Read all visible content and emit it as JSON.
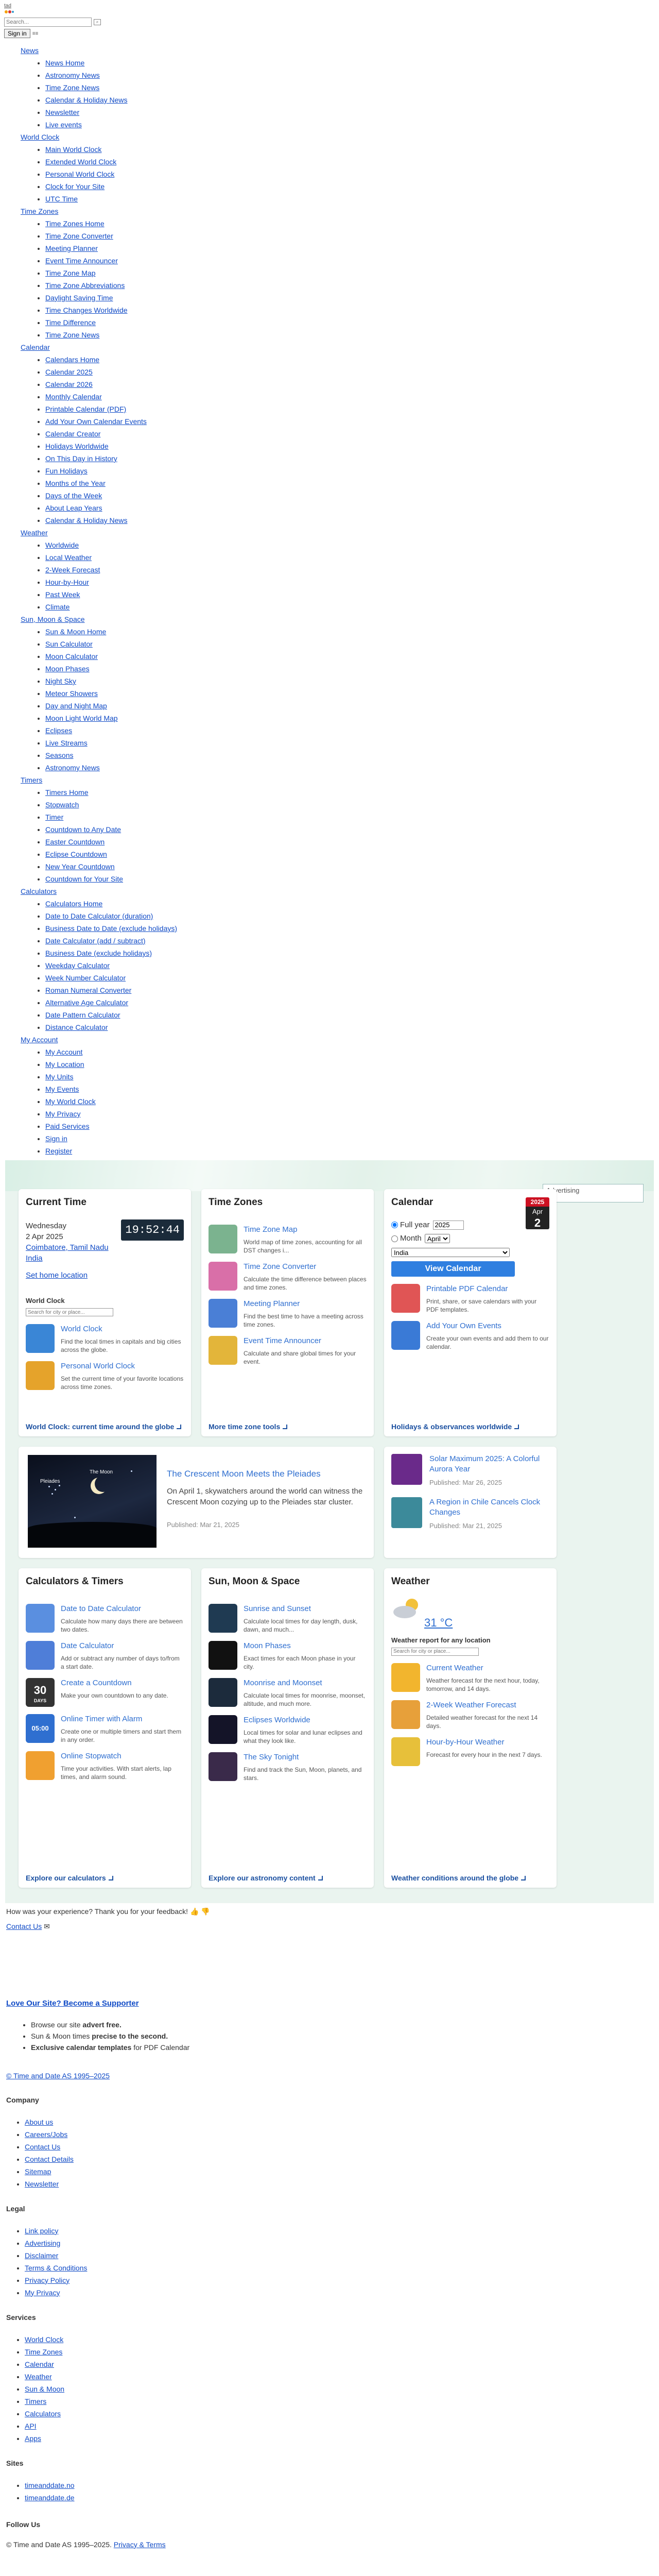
{
  "header": {
    "logo_label": "tad",
    "search_placeholder": "Search...",
    "search_button": "⌕",
    "signin_label": "Sign in",
    "menu_toggle": "≡≡"
  },
  "nav": [
    {
      "label": "News",
      "items": [
        "News Home",
        "Astronomy News",
        "Time Zone News",
        "Calendar & Holiday News",
        "Newsletter",
        "Live events"
      ]
    },
    {
      "label": "World Clock",
      "items": [
        "Main World Clock",
        "Extended World Clock",
        "Personal World Clock",
        "Clock for Your Site",
        "UTC Time"
      ]
    },
    {
      "label": "Time Zones",
      "items": [
        "Time Zones Home",
        "Time Zone Converter",
        "Meeting Planner",
        "Event Time Announcer",
        "Time Zone Map",
        "Time Zone Abbreviations",
        "Daylight Saving Time",
        "Time Changes Worldwide",
        "Time Difference",
        "Time Zone News"
      ]
    },
    {
      "label": "Calendar",
      "items": [
        "Calendars Home",
        "Calendar 2025",
        "Calendar 2026",
        "Monthly Calendar",
        "Printable Calendar (PDF)",
        "Add Your Own Calendar Events",
        "Calendar Creator",
        "Holidays Worldwide",
        "On This Day in History",
        "Fun Holidays",
        "Months of the Year",
        "Days of the Week",
        "About Leap Years",
        "Calendar & Holiday News"
      ]
    },
    {
      "label": "Weather",
      "items": [
        "Worldwide",
        "Local Weather",
        "2-Week Forecast",
        "Hour-by-Hour",
        "Past Week",
        "Climate"
      ]
    },
    {
      "label": "Sun, Moon & Space",
      "items": [
        "Sun & Moon Home",
        "Sun Calculator",
        "Moon Calculator",
        "Moon Phases",
        "Night Sky",
        "Meteor Showers",
        "Day and Night Map",
        "Moon Light World Map",
        "Eclipses",
        "Live Streams",
        "Seasons",
        "Astronomy News"
      ]
    },
    {
      "label": "Timers",
      "items": [
        "Timers Home",
        "Stopwatch",
        "Timer",
        "Countdown to Any Date",
        "Easter Countdown",
        "Eclipse Countdown",
        "New Year Countdown",
        "Countdown for Your Site"
      ]
    },
    {
      "label": "Calculators",
      "items": [
        "Calculators Home",
        "Date to Date Calculator (duration)",
        "Business Date to Date (exclude holidays)",
        "Date Calculator (add / subtract)",
        "Business Date (exclude holidays)",
        "Weekday Calculator",
        "Week Number Calculator",
        "Roman Numeral Converter",
        "Alternative Age Calculator",
        "Date Pattern Calculator",
        "Distance Calculator"
      ]
    },
    {
      "label": "My Account",
      "items": [
        "My Account",
        "My Location",
        "My Units",
        "My Events",
        "My World Clock",
        "My Privacy",
        "Paid Services",
        "Sign in",
        "Register"
      ]
    }
  ],
  "advertising": "Advertising",
  "current_time": {
    "title": "Current Time",
    "clock": "19:52:44",
    "weekday": "Wednesday",
    "date": "2 Apr 2025",
    "city": "Coimbatore, Tamil Nadu",
    "country": "India",
    "set_home": "Set home location",
    "world_clock_title": "World Clock",
    "wc_search_placeholder": "Search for city or place...",
    "tools": [
      {
        "title": "World Clock",
        "desc": "Find the local times in capitals and big cities across the globe.",
        "icon": "globe-icon",
        "color": "#3a86d6"
      },
      {
        "title": "Personal World Clock",
        "desc": "Set the current time of your favorite locations across time zones.",
        "icon": "clock-person-icon",
        "color": "#e5a32b"
      }
    ],
    "footer": "World Clock: current time around the globe"
  },
  "time_zones": {
    "title": "Time Zones",
    "tools": [
      {
        "title": "Time Zone Map",
        "desc": "World map of time zones, accounting for all DST changes i...",
        "icon": "map-icon",
        "color": "#7bb38f"
      },
      {
        "title": "Time Zone Converter",
        "desc": "Calculate the time difference between places and time zones.",
        "icon": "converter-icon",
        "color": "#d96fa8"
      },
      {
        "title": "Meeting Planner",
        "desc": "Find the best time to have a meeting across time zones.",
        "icon": "meeting-icon",
        "color": "#4a7fd6"
      },
      {
        "title": "Event Time Announcer",
        "desc": "Calculate and share global times for your event.",
        "icon": "announcer-icon",
        "color": "#e3b53a"
      }
    ],
    "footer": "More time zone tools"
  },
  "calendar": {
    "title": "Calendar",
    "full_year_label": "Full year",
    "year_value": "2025",
    "month_label": "Month",
    "month_value": "April",
    "country_value": "India",
    "view_button": "View Calendar",
    "badge_year": "2025",
    "badge_month": "Apr",
    "badge_day": "2",
    "tools": [
      {
        "title": "Printable PDF Calendar",
        "desc": "Print, share, or save calendars with your PDF templates.",
        "icon": "pdf-icon",
        "color": "#e05555"
      },
      {
        "title": "Add Your Own Events",
        "desc": "Create your own events and add them to our calendar.",
        "icon": "add-event-icon",
        "color": "#3a7ad6"
      }
    ],
    "footer": "Holidays & observances worldwide"
  },
  "news": {
    "main": {
      "title": "The Crescent Moon Meets the Pleiades",
      "desc": "On April 1, skywatchers around the world can witness the Crescent Moon cozying up to the Pleiades star cluster.",
      "published": "Published: Mar 21, 2025",
      "img_label_1": "The Moon",
      "img_label_2": "Pleiades"
    },
    "side": [
      {
        "title": "Solar Maximum 2025: A Colorful Aurora Year",
        "published": "Published: Mar 26, 2025",
        "color": "#6a2a8a"
      },
      {
        "title": "A Region in Chile Cancels Clock Changes",
        "published": "Published: Mar 21, 2025",
        "color": "#3c8a9a"
      }
    ]
  },
  "calculators": {
    "title": "Calculators & Timers",
    "tools": [
      {
        "title": "Date to Date Calculator",
        "desc": "Calculate how many days there are between two dates.",
        "icon": "calendar-calc-icon",
        "color": "#5a8fe0"
      },
      {
        "title": "Date Calculator",
        "desc": "Add or subtract any number of days to/from a start date.",
        "icon": "date-calc-icon",
        "color": "#4f7ed8"
      },
      {
        "title": "Create a Countdown",
        "desc": "Make your own countdown to any date.",
        "icon": "countdown-icon",
        "color": "#333333",
        "badge": "30",
        "badge_sub": "DAYS"
      },
      {
        "title": "Online Timer with Alarm",
        "desc": "Create one or multiple timers and start them in any order.",
        "icon": "timer-icon",
        "color": "#2f6fd0",
        "badge": "05:00"
      },
      {
        "title": "Online Stopwatch",
        "desc": "Time your activities. With start alerts, lap times, and alarm sound.",
        "icon": "stopwatch-icon",
        "color": "#f0a030"
      }
    ],
    "footer": "Explore our calculators"
  },
  "astro": {
    "title": "Sun, Moon & Space",
    "tools": [
      {
        "title": "Sunrise and Sunset",
        "desc": "Calculate local times for day length, dusk, dawn, and much...",
        "icon": "sunrise-icon",
        "color": "#1f3a52"
      },
      {
        "title": "Moon Phases",
        "desc": "Exact times for each Moon phase in your city.",
        "icon": "moon-phase-icon",
        "color": "#111111"
      },
      {
        "title": "Moonrise and Moonset",
        "desc": "Calculate local times for moonrise, moonset, altitude, and much more.",
        "icon": "moonrise-icon",
        "color": "#1c2b3c"
      },
      {
        "title": "Eclipses Worldwide",
        "desc": "Local times for solar and lunar eclipses and what they look like.",
        "icon": "eclipse-icon",
        "color": "#141428"
      },
      {
        "title": "The Sky Tonight",
        "desc": "Find and track the Sun, Moon, planets, and stars.",
        "icon": "sky-icon",
        "color": "#3a2a4a"
      }
    ],
    "footer": "Explore our astronomy content"
  },
  "weather": {
    "title": "Weather",
    "temp": "31 °C",
    "report_label": "Weather report for any location",
    "search_placeholder": "Search for city or place...",
    "tools": [
      {
        "title": "Current Weather",
        "desc": "Weather forecast for the next hour, today, tomorrow, and 14 days.",
        "icon": "weather-icon",
        "color": "#f2b52e"
      },
      {
        "title": "2-Week Weather Forecast",
        "desc": "Detailed weather forecast for the next 14 days.",
        "icon": "forecast-icon",
        "color": "#e7a03a"
      },
      {
        "title": "Hour-by-Hour Weather",
        "desc": "Forecast for every hour in the next 7 days.",
        "icon": "hourly-icon",
        "color": "#e7c03a"
      }
    ],
    "footer": "Weather conditions around the globe"
  },
  "feedback": {
    "text": "How was your experience? Thank you for your feedback!",
    "contact": "Contact Us"
  },
  "supporter": {
    "title": "Love Our Site? Become a Supporter",
    "items": [
      {
        "pre": "Browse our site ",
        "bold": "advert free.",
        "post": ""
      },
      {
        "pre": "Sun & Moon times ",
        "bold": "precise to the second.",
        "post": ""
      },
      {
        "pre": "",
        "bold": "Exclusive calendar templates",
        "post": " for PDF Calendar"
      }
    ]
  },
  "copyright": "© Time and Date AS 1995–2025",
  "footer": {
    "company": {
      "title": "Company",
      "items": [
        "About us",
        "Careers/Jobs",
        "Contact Us",
        "Contact Details",
        "Sitemap",
        "Newsletter"
      ]
    },
    "legal": {
      "title": "Legal",
      "items": [
        "Link policy",
        "Advertising",
        "Disclaimer",
        "Terms & Conditions",
        "Privacy Policy",
        "My Privacy"
      ]
    },
    "services": {
      "title": "Services",
      "items": [
        "World Clock",
        "Time Zones",
        "Calendar",
        "Weather",
        "Sun & Moon",
        "Timers",
        "Calculators",
        "API",
        "Apps"
      ]
    },
    "sites": {
      "title": "Sites",
      "items": [
        "timeanddate.no",
        "timeanddate.de"
      ]
    },
    "follow": "Follow Us",
    "bottom_text": "© Time and Date AS 1995–2025.",
    "bottom_link": "Privacy & Terms"
  }
}
